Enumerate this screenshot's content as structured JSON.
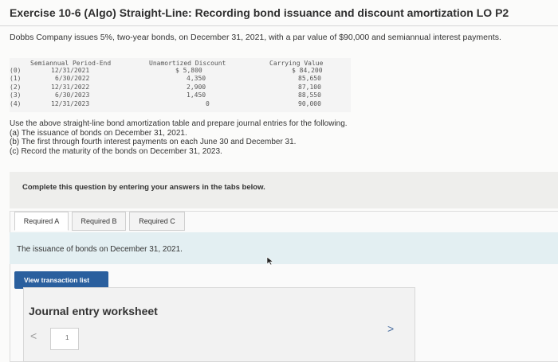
{
  "header": {
    "title": "Exercise 10-6 (Algo) Straight-Line: Recording bond issuance and discount amortization LO P2"
  },
  "problem": {
    "intro": "Dobbs Company issues 5%, two-year bonds, on December 31, 2021, with a par value of $90,000 and semiannual interest payments."
  },
  "amortization_table": {
    "headers": {
      "period": "Semiannual Period-End",
      "discount": "Unamortized Discount",
      "carrying": "Carrying Value"
    },
    "rows": [
      {
        "idx": "(0)",
        "date": "12/31/2021",
        "discount": "$ 5,800",
        "carrying": "$ 84,200"
      },
      {
        "idx": "(1)",
        "date": "6/30/2022",
        "discount": "4,350",
        "carrying": "85,650"
      },
      {
        "idx": "(2)",
        "date": "12/31/2022",
        "discount": "2,900",
        "carrying": "87,100"
      },
      {
        "idx": "(3)",
        "date": "6/30/2023",
        "discount": "1,450",
        "carrying": "88,550"
      },
      {
        "idx": "(4)",
        "date": "12/31/2023",
        "discount": "0",
        "carrying": "90,000"
      }
    ]
  },
  "instructions": {
    "lead": "Use the above straight-line bond amortization table and prepare journal entries for the following.",
    "a": "(a) The issuance of bonds on December 31, 2021.",
    "b": "(b) The first through fourth interest payments on each June 30 and December 31.",
    "c": "(c) Record the maturity of the bonds on December 31, 2023."
  },
  "complete_prompt": "Complete this question by entering your answers in the tabs below.",
  "tabs": [
    {
      "label": "Required A"
    },
    {
      "label": "Required B"
    },
    {
      "label": "Required C"
    }
  ],
  "tab_description": "The issuance of bonds on December 31, 2021.",
  "buttons": {
    "view_transaction_list": "View transaction list"
  },
  "worksheet": {
    "title": "Journal entry worksheet",
    "prev": "<",
    "next": ">",
    "current_page": "1"
  },
  "colors": {
    "primary_button": "#2a5f9e",
    "tab_band": "#e3eff2"
  }
}
